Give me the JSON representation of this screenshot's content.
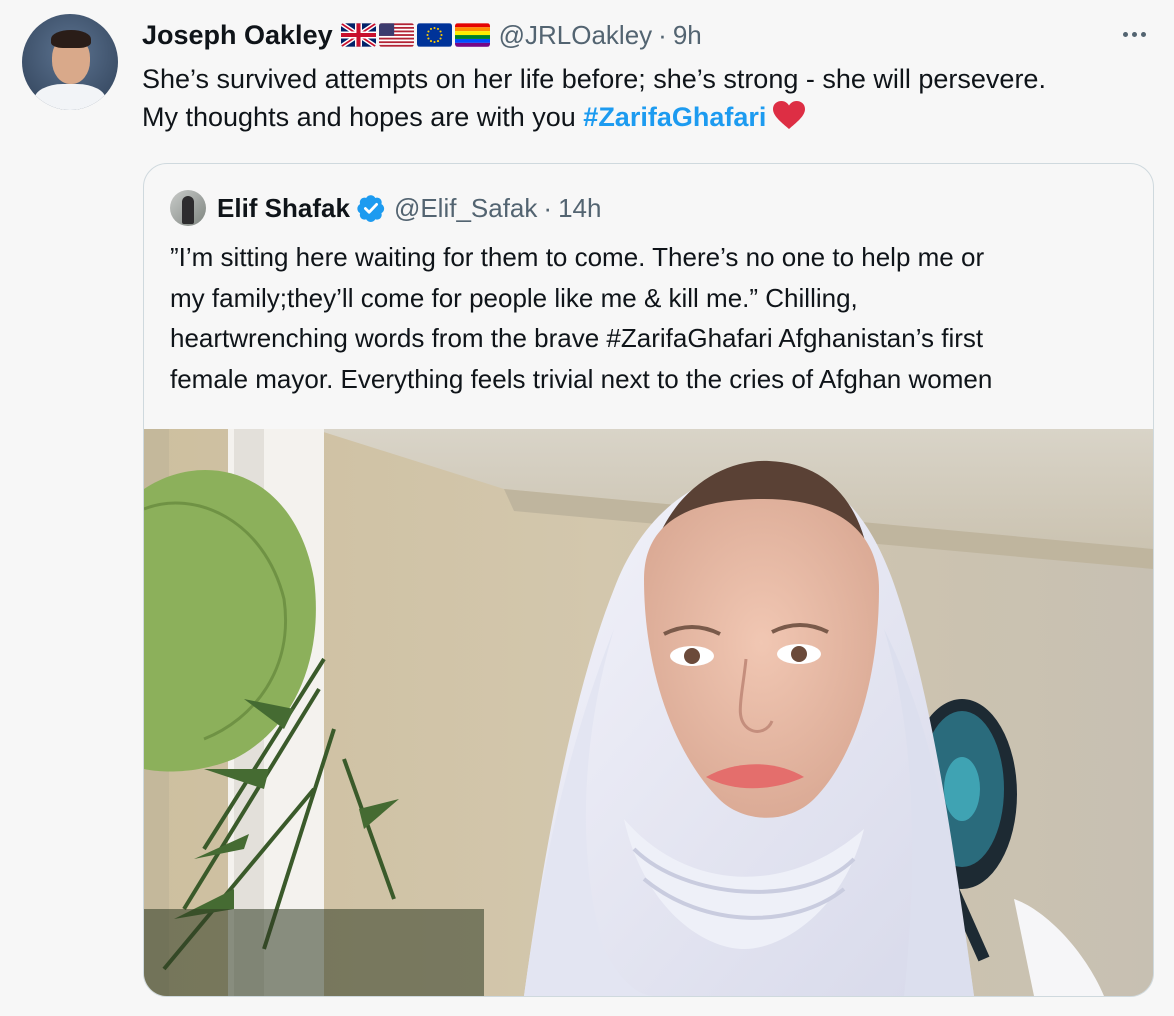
{
  "tweet": {
    "author_name": "Joseph Oakley",
    "flags": [
      "uk-flag-icon",
      "us-flag-icon",
      "eu-flag-icon",
      "rainbow-flag-icon"
    ],
    "handle": "@JRLOakley",
    "separator": "·",
    "time": "9h",
    "text_line1": "She’s survived attempts on her life before; she’s strong - she will persevere.",
    "text_line2_prefix": "My thoughts and hopes are with you",
    "hashtag": "#ZarifaGhafari",
    "emoji_icon": "red-heart-icon"
  },
  "quoted": {
    "author_name": "Elif Shafak",
    "verified_icon": "verified-badge-icon",
    "handle": "@Elif_Safak",
    "separator": "·",
    "time": "14h",
    "text_line1": "”I’m sitting here waiting for them to come. There’s no one to help me or",
    "text_line2": "my family;they’ll come for people like me & kill me.” Chilling,",
    "text_line3": "heartwrenching words from the brave #ZarifaGhafari Afghanistan’s first",
    "text_line4": "female mayor. Everything feels trivial next to the cries of Afghan women"
  },
  "colors": {
    "link": "#1d9bf0",
    "text": "#0f1419",
    "secondary": "#536471",
    "heart": "#e0245e",
    "border": "#cfd9de"
  }
}
